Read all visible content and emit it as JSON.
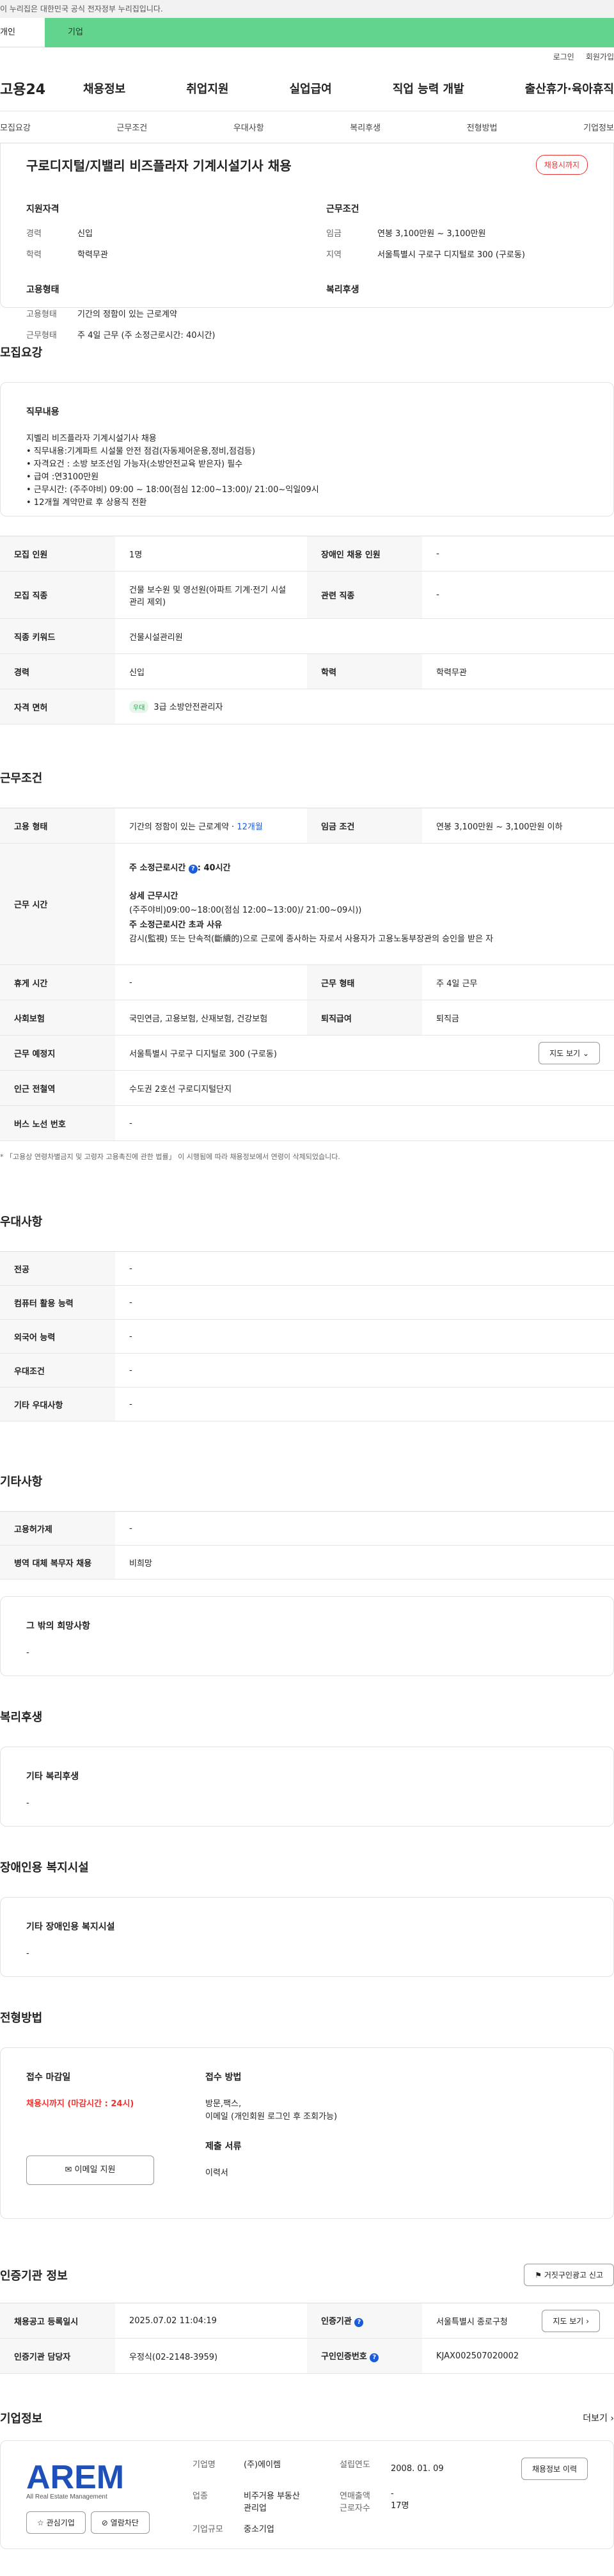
{
  "gov_banner": "이 누리집은 대한민국 공식 전자정부 누리집입니다.",
  "top_tabs": {
    "a": "개인",
    "b": "기업"
  },
  "util": {
    "login": "로그인",
    "join": "회원가입"
  },
  "logo": "고용24",
  "gnb": [
    "채용정보",
    "취업지원",
    "실업급여",
    "직업 능력 개발",
    "출산휴가·육아휴직"
  ],
  "subnav": [
    "모집요강",
    "근무조건",
    "우대사항",
    "복리후생",
    "전형방법",
    "기업정보"
  ],
  "job": {
    "title": "구로디지털/지밸리 비즈플라자 기계시설기사 채용",
    "status": "채용시까지",
    "qual_title": "지원자격",
    "qual": [
      {
        "k": "경력",
        "v": "신입"
      },
      {
        "k": "학력",
        "v": "학력무관"
      }
    ],
    "cond_title": "근무조건",
    "cond": [
      {
        "k": "임금",
        "v": "연봉 3,100만원 ~ 3,100만원"
      },
      {
        "k": "지역",
        "v": "서울특별시 구로구 디지털로 300 (구로동)"
      }
    ],
    "form_title": "고용형태",
    "form": [
      {
        "k": "고용형태",
        "v": "기간의 정함이 있는 근로계약"
      },
      {
        "k": "근무형태",
        "v": "주 4일 근무 (주 소정근로시간: 40시간)"
      }
    ],
    "welfare_title": "복리후생"
  },
  "recruit": {
    "title": "모집요강",
    "duty_title": "직무내용",
    "duty_lines": [
      "지벨리 비즈플라자 기계시설기사 채용",
      "• 직무내용:기계파트 시설물 안전 점검(자동제어운용,정비,점검등)",
      "• 자격요건 : 소방 보조선임 가능자(소방안전교육 받은자) 필수",
      "• 급여 :연3100만원",
      "• 근무시간:   (주주야비) 09:00 ~ 18:00(점심 12:00~13:00)/ 21:00~익일09시",
      "• 12개월 계약만료 후 상용직 전환"
    ],
    "table": {
      "people_k": "모집 인원",
      "people_v": "1명",
      "disabled_k": "장애인 채용 인원",
      "disabled_v": "-",
      "job_k": "모집 직종",
      "job_v": "건물 보수원 및 영선원(아파트 기계·전기 시설관리 제외)",
      "related_k": "관련 직종",
      "related_v": "-",
      "keyword_k": "직종 키워드",
      "keyword_v": "건물시설관리원",
      "career_k": "경력",
      "career_v": "신입",
      "edu_k": "학력",
      "edu_v": "학력무관",
      "license_k": "자격 면허",
      "license_badge": "우대",
      "license_v": "3급 소방안전관리자"
    }
  },
  "work": {
    "title": "근무조건",
    "emp_k": "고용 형태",
    "emp_v": "기간의 정함이 있는 근로계약 · ",
    "emp_months": "12개월",
    "wage_k": "임금 조건",
    "wage_v": "연봉 3,100만원 ~ 3,100만원 이하",
    "time_k": "근무 시간",
    "time_week": "주 소정근로시간 ",
    "time_week_v": ": 40시간",
    "time_detail_title": "상세 근무시간",
    "time_detail": "(주주야비)09:00~18:00(점심 12:00~13:00)/ 21:00~09시))",
    "time_over_title": "주 소정근로시간 초과 사유",
    "time_over": "감시(監視) 또는 단속적(斷續的)으로 근로에 종사하는 자로서 사용자가 고용노동부장관의 승인을 받은 자",
    "rest_k": "휴게 시간",
    "rest_v": "-",
    "shape_k": "근무 형태",
    "shape_v": "주 4일 근무",
    "ins_k": "사회보험",
    "ins_v": "국민연금, 고용보험, 산재보험, 건강보험",
    "ret_k": "퇴직급여",
    "ret_v": "퇴직금",
    "place_k": "근무 예정지",
    "place_v": "서울특별시 구로구 디지털로 300 (구로동)",
    "map_btn": "지도 보기",
    "subway_k": "인근 전철역",
    "subway_v": "수도권 2호선 구로디지털단지",
    "bus_k": "버스 노선 번호",
    "bus_v": "-",
    "note": "* 「고용상 연령차별금지 및 고령자 고용촉진에 관한 법률」 이 시행됨에 따라 채용정보에서 연령이 삭제되었습니다."
  },
  "prefer": {
    "title": "우대사항",
    "rows": [
      {
        "k": "전공",
        "v": "-"
      },
      {
        "k": "컴퓨터 활용 능력",
        "v": "-"
      },
      {
        "k": "외국어 능력",
        "v": "-"
      },
      {
        "k": "우대조건",
        "v": "-"
      },
      {
        "k": "기타 우대사항",
        "v": "-"
      }
    ]
  },
  "etc": {
    "title": "기타사항",
    "rows": [
      {
        "k": "고용허가제",
        "v": "-"
      },
      {
        "k": "병역 대체 복무자 채용",
        "v": "비희망"
      }
    ],
    "wish_title": "그 밖의 희망사항",
    "wish_v": "-"
  },
  "welfare": {
    "title": "복리후생",
    "sub": "기타 복리후생",
    "v": "-"
  },
  "disabled": {
    "title": "장애인용 복지시설",
    "sub": "기타 장애인용 복지시설",
    "v": "-"
  },
  "process": {
    "title": "전형방법",
    "deadline_title": "접수 마감일",
    "deadline_v": "채용시까지 (마감시간 : 24시)",
    "email_btn": "이메일 지원",
    "method_title": "접수 방법",
    "method_v1": "방문,팩스,",
    "method_v2": "이메일 (개인회원 로그인 후 조회가능)",
    "docs_title": "제출 서류",
    "docs_v": "이력서"
  },
  "cert": {
    "title": "인증기관 정보",
    "report_btn": "거짓구인광고 신고",
    "reg_k": "채용공고 등록일시",
    "reg_v": "2025.07.02 11:04:19",
    "org_k": "인증기관",
    "org_v": "서울특별시 종로구청",
    "map_btn": "지도 보기",
    "mgr_k": "인증기관 담당자",
    "mgr_v": "우정식(02-2148-3959)",
    "certno_k": "구인인증번호",
    "certno_v": "KJAX002507020002"
  },
  "company": {
    "title": "기업정보",
    "more": "더보기",
    "logo_text": "AREM",
    "logo_sub": "All Real Estate Management",
    "fav_btn": "관심기업",
    "block_btn": "열람차단",
    "name_k": "기업명",
    "name_v": "(주)에이렘",
    "found_k": "설립연도",
    "found_v": "2008. 01. 09",
    "history_btn": "채용정보 이력",
    "biz_k": "업종",
    "biz_v1": "비주거용 부동산",
    "biz_v2": "관리업",
    "sales_k": "연매출액",
    "sales_v": "-",
    "staff_k": "근로자수",
    "staff_v": "17명",
    "size_k": "기업규모",
    "size_v": "중소기업"
  }
}
